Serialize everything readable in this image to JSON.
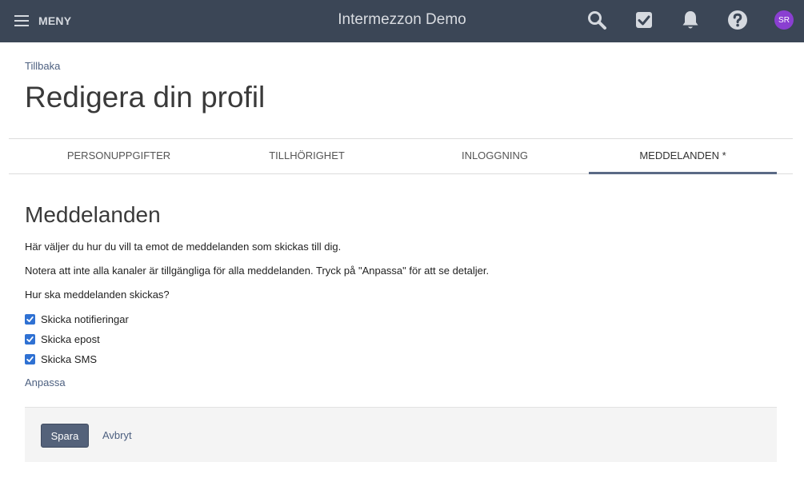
{
  "header": {
    "menu_label": "MENY",
    "app_title": "Intermezzon Demo",
    "avatar_initials": "SR",
    "avatar_color": "#8a3fd1",
    "icons": [
      "search-icon",
      "tasks-checkbox-icon",
      "bell-icon",
      "help-icon"
    ]
  },
  "page": {
    "back_link": "Tillbaka",
    "title": "Redigera din profil"
  },
  "tabs": [
    {
      "label": "PERSONUPPGIFTER",
      "active": false
    },
    {
      "label": "TILLHÖRIGHET",
      "active": false
    },
    {
      "label": "INLOGGNING",
      "active": false
    },
    {
      "label": "MEDDELANDEN *",
      "active": true
    }
  ],
  "notifications": {
    "section_title": "Meddelanden",
    "intro": "Här väljer du hur du vill ta emot de meddelanden som skickas till dig.",
    "note": "Notera att inte alla kanaler är tillgängliga för alla meddelanden. Tryck på \"Anpassa\" för att se detaljer.",
    "question": "Hur ska meddelanden skickas?",
    "options": [
      {
        "label": "Skicka notifieringar",
        "checked": true
      },
      {
        "label": "Skicka epost",
        "checked": true
      },
      {
        "label": "Skicka SMS",
        "checked": true
      }
    ],
    "customize_link": "Anpassa"
  },
  "actions": {
    "save_label": "Spara",
    "cancel_label": "Avbryt"
  },
  "colors": {
    "topbar": "#3b4656",
    "accent": "#54627a",
    "checkbox": "#2f71d3",
    "link": "#4d6080"
  }
}
